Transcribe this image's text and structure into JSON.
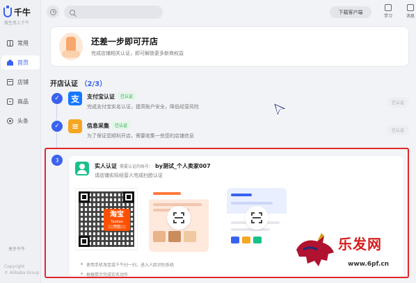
{
  "app": {
    "name": "千牛",
    "slogan": "做生意上千牛"
  },
  "sidebar": {
    "items": [
      {
        "label": "常用",
        "icon": "grid-icon"
      },
      {
        "label": "首页",
        "icon": "home-icon",
        "active": true
      },
      {
        "label": "店铺",
        "icon": "store-icon"
      },
      {
        "label": "商品",
        "icon": "goods-icon"
      },
      {
        "label": "头条",
        "icon": "headline-icon"
      }
    ],
    "about": "关于千牛",
    "copyright_1": "Copyright",
    "copyright_2": "© Alibaba Group"
  },
  "topbar": {
    "search_placeholder": "",
    "download_label": "下载客户端",
    "learn_label": "学习",
    "message_label": "消息"
  },
  "banner": {
    "title": "还差一步即可开店",
    "desc": "完成店铺相关认证，即可解锁更多新商权益"
  },
  "section": {
    "title": "开店认证",
    "progress": "2/3"
  },
  "steps": [
    {
      "name": "支付宝认证",
      "badge": "已认证",
      "desc": "完成支付宝实名认证，提高账户安全，降低经营风险",
      "btn": "已认证"
    },
    {
      "name": "信息采集",
      "badge": "已认证",
      "desc": "为了保证您顺利开店，需要收集一些您的店铺信息",
      "btn": "已认证"
    }
  ],
  "face_step": {
    "number": "3",
    "title": "实人认证",
    "hint": "需要认证的账号：",
    "account": "by测试_个人卖家007",
    "desc": "请店铺实际经营人完成扫脸认证",
    "qr_brand": "淘宝",
    "qr_brand_en": "Taobao",
    "qr_brand_sub": "开店",
    "instruction_1": "使用手机淘宝或千牛扫一扫，进入人脸识别系统",
    "instruction_2": "根据提示完成实名动作"
  },
  "watermark": {
    "text": "乐发网",
    "url": "www.6pf.cn"
  },
  "colors": {
    "accent": "#3a62f0",
    "success": "#2aa64b",
    "highlight_border": "#e02727",
    "taobao": "#ff5000"
  }
}
